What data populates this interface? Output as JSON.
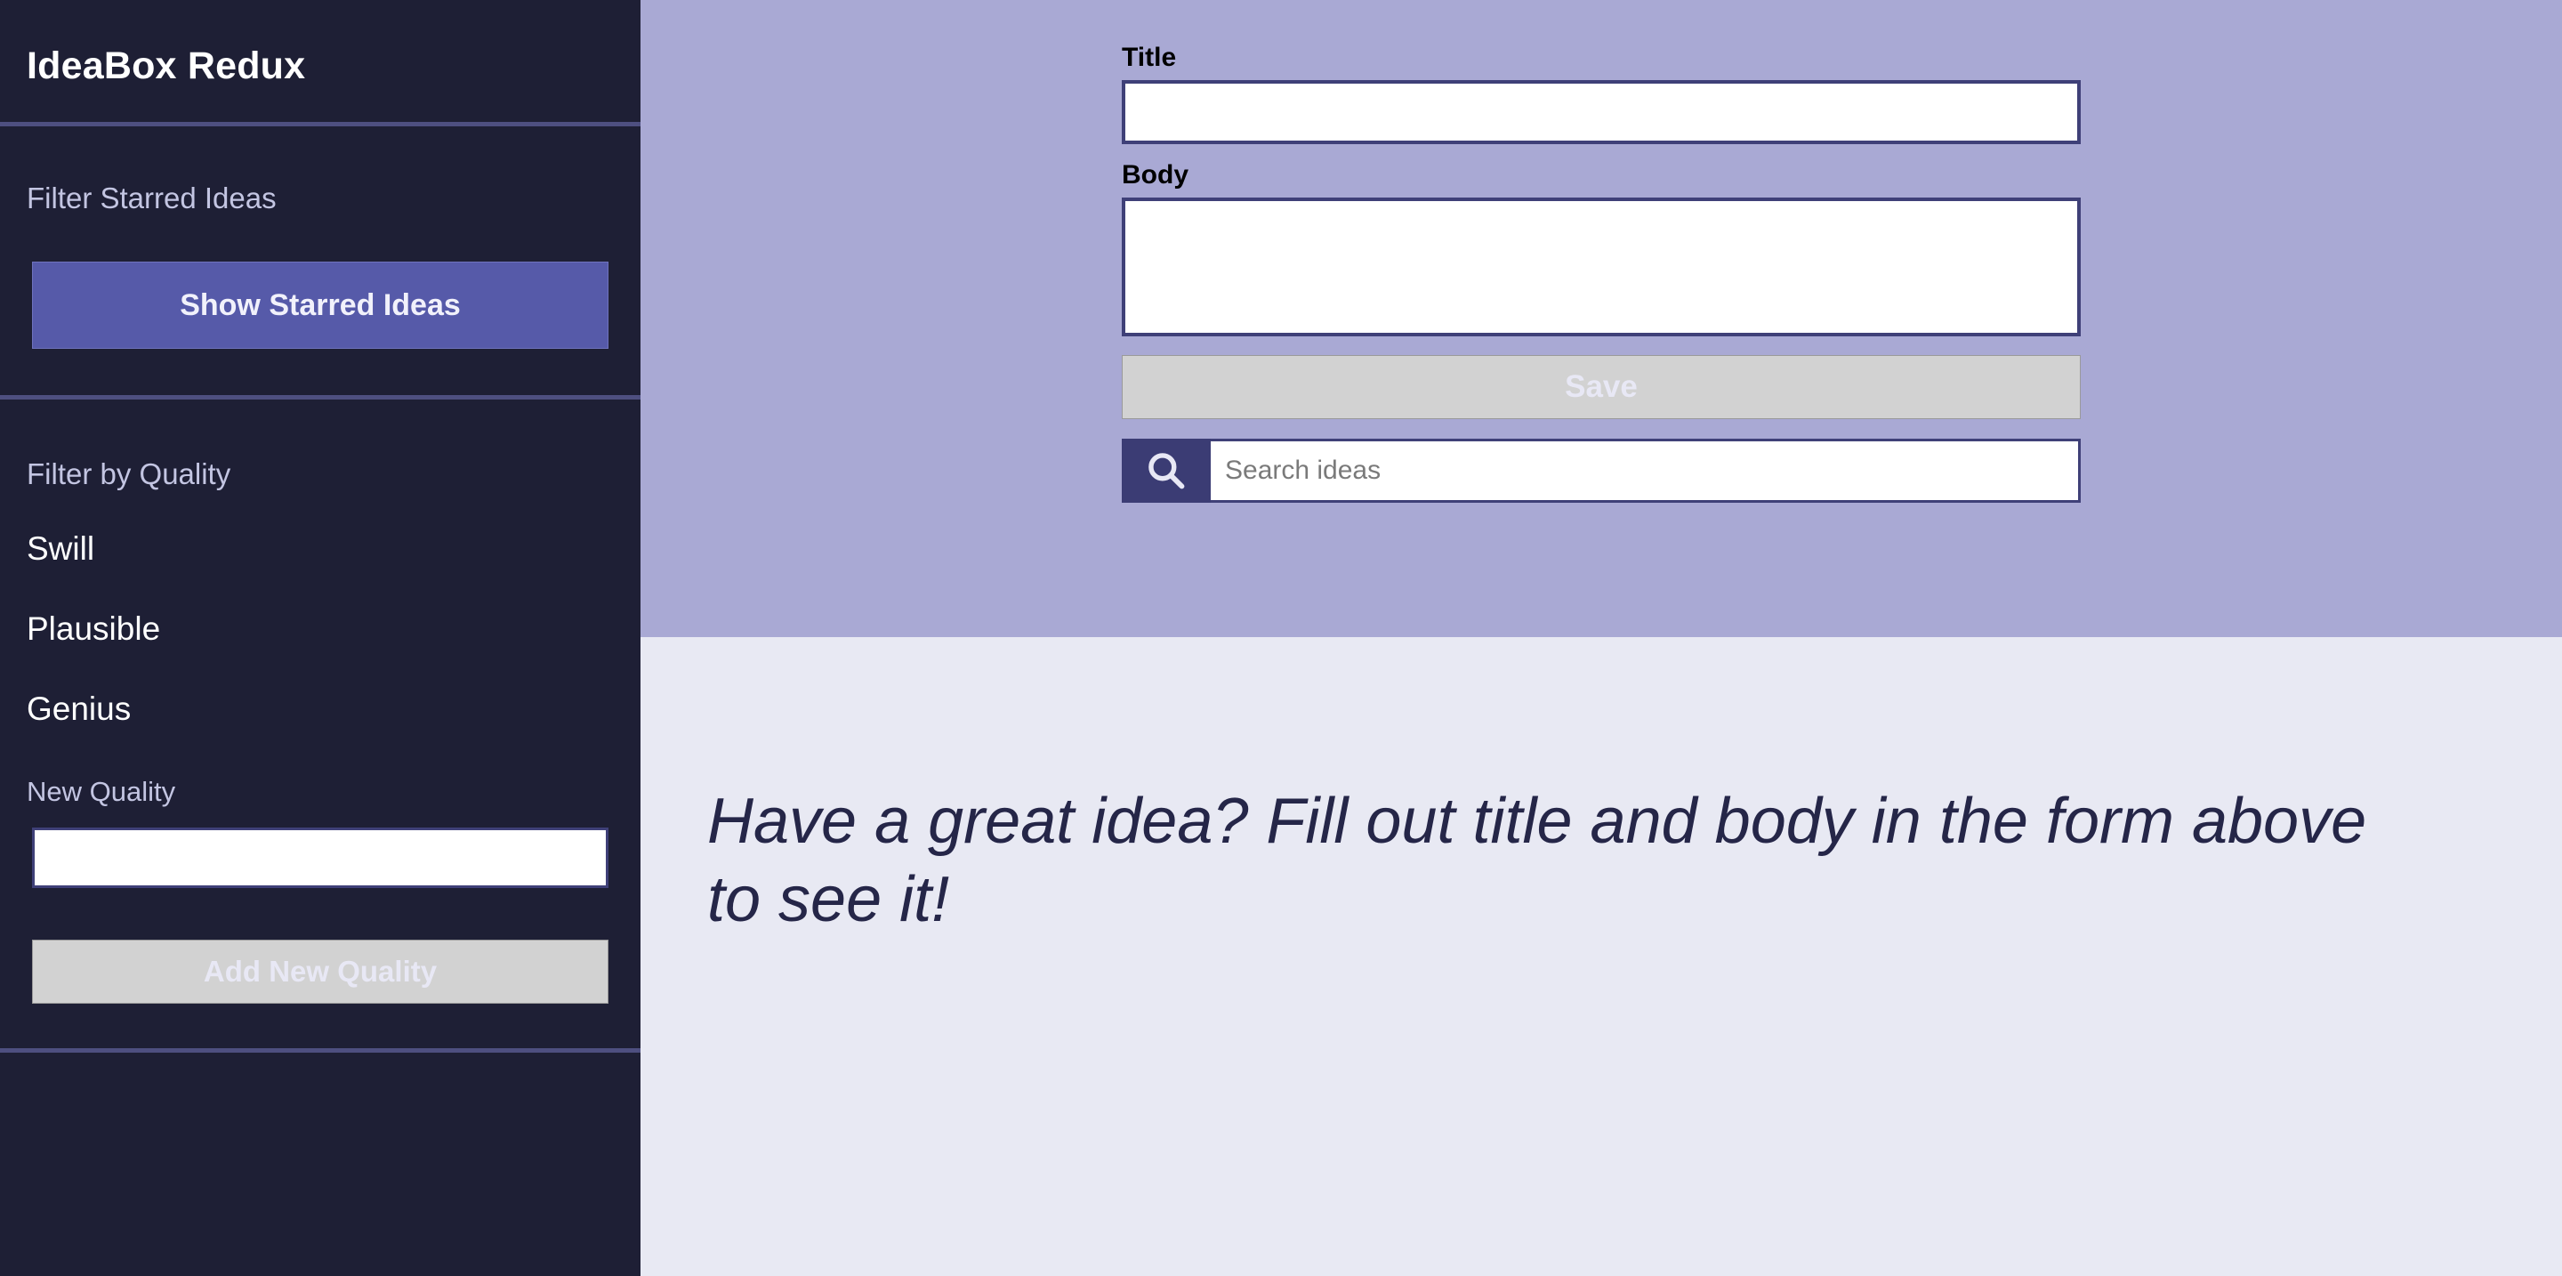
{
  "sidebar": {
    "app_title": "IdeaBox Redux",
    "starred": {
      "label": "Filter Starred Ideas",
      "button_label": "Show Starred Ideas"
    },
    "quality": {
      "label": "Filter by Quality",
      "items": [
        {
          "label": "Swill"
        },
        {
          "label": "Plausible"
        },
        {
          "label": "Genius"
        }
      ],
      "new_quality_label": "New Quality",
      "new_quality_value": "",
      "add_button_label": "Add New Quality"
    }
  },
  "form": {
    "title_label": "Title",
    "title_value": "",
    "body_label": "Body",
    "body_value": "",
    "save_label": "Save",
    "search": {
      "icon": "search-icon",
      "value": "",
      "placeholder": "Search ideas"
    }
  },
  "content": {
    "empty_message": "Have a great idea? Fill out title and body in the form above to see it!"
  },
  "colors": {
    "sidebar_bg": "#1e1f35",
    "sidebar_divider": "#4e4f80",
    "accent_button": "#565aa9",
    "form_panel_bg": "#a9a9d4",
    "content_bg": "#e8e9f3",
    "input_border": "#3f4078",
    "disabled_button": "#d2d2d2",
    "search_icon_bg": "#3b3c74",
    "muted_text": "#c3c5e2",
    "content_text": "#252648"
  }
}
